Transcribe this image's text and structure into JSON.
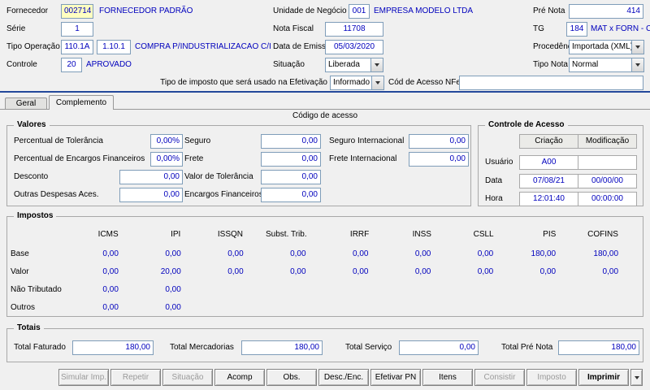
{
  "colors": {
    "field_text_blue": "#0000bd",
    "fornecedor_highlight": "#ffffc0",
    "separator_blue": "#23489b"
  },
  "header": {
    "fornecedor": {
      "label": "Fornecedor",
      "code": "002714",
      "name": "FORNECEDOR PADRÃO"
    },
    "unidade_negocio": {
      "label": "Unidade de Negócio",
      "code": "001",
      "name": "EMPRESA MODELO LTDA"
    },
    "pre_nota": {
      "label": "Pré Nota",
      "value": "414"
    },
    "serie": {
      "label": "Série",
      "value": "1"
    },
    "nota_fiscal": {
      "label": "Nota Fiscal",
      "value": "11708"
    },
    "tg": {
      "label": "TG",
      "code": "184",
      "name": "MAT x FORN - CR"
    },
    "tipo_operacao": {
      "label": "Tipo Operação",
      "code1": "110.1A",
      "code2": "1.10.1",
      "desc": "COMPRA P/INDUSTRIALIZACAO C/ICMS"
    },
    "data_emissao": {
      "label": "Data de Emissão",
      "value": "05/03/2020"
    },
    "procedencia": {
      "label": "Procedência",
      "value": "Importada (XML)"
    },
    "controle": {
      "label": "Controle",
      "code": "20",
      "name": "APROVADO"
    },
    "situacao": {
      "label": "Situação",
      "value": "Liberada"
    },
    "tipo_nota": {
      "label": "Tipo Nota",
      "value": "Normal"
    },
    "tipo_imposto": {
      "label": "Tipo de imposto que será usado na Efetivação",
      "value": "Informado"
    },
    "cod_acesso_nfe": {
      "label": "Cód de Acesso NFe",
      "value": ""
    }
  },
  "tabs": [
    {
      "label": "Geral"
    },
    {
      "label": "Complemento"
    }
  ],
  "active_tab": "Complemento",
  "section_title": "Código de acesso",
  "valores": {
    "title": "Valores",
    "col1": [
      {
        "label": "Percentual de Tolerância",
        "value": "0,00%"
      },
      {
        "label": "Percentual de Encargos Financeiros",
        "value": "0,00%"
      },
      {
        "label": "Desconto",
        "value": "0,00"
      },
      {
        "label": "Outras Despesas Aces.",
        "value": "0,00"
      }
    ],
    "col2": [
      {
        "label": "Seguro",
        "value": "0,00"
      },
      {
        "label": "Frete",
        "value": "0,00"
      },
      {
        "label": "Valor de Tolerância",
        "value": "0,00"
      },
      {
        "label": "Encargos Financeiros",
        "value": "0,00"
      }
    ],
    "col3": [
      {
        "label": "Seguro Internacional",
        "value": "0,00"
      },
      {
        "label": "Frete Internacional",
        "value": "0,00"
      }
    ]
  },
  "controle_acesso": {
    "title": "Controle de Acesso",
    "columns": [
      "Criação",
      "Modificação"
    ],
    "rows": [
      {
        "label": "Usuário",
        "criacao": "A00",
        "modificacao": ""
      },
      {
        "label": "Data",
        "criacao": "07/08/21",
        "modificacao": "00/00/00"
      },
      {
        "label": "Hora",
        "criacao": "12:01:40",
        "modificacao": "00:00:00"
      }
    ]
  },
  "impostos": {
    "title": "Impostos",
    "columns": [
      "ICMS",
      "IPI",
      "ISSQN",
      "Subst. Trib.",
      "IRRF",
      "INSS",
      "CSLL",
      "PIS",
      "COFINS"
    ],
    "rows": [
      {
        "label": "Base",
        "values": [
          "0,00",
          "0,00",
          "0,00",
          "0,00",
          "0,00",
          "0,00",
          "0,00",
          "180,00",
          "180,00"
        ]
      },
      {
        "label": "Valor",
        "values": [
          "0,00",
          "20,00",
          "0,00",
          "0,00",
          "0,00",
          "0,00",
          "0,00",
          "0,00",
          "0,00"
        ]
      },
      {
        "label": "Não Tributado",
        "values": [
          "0,00",
          "0,00",
          "",
          "",
          "",
          "",
          "",
          "",
          ""
        ]
      },
      {
        "label": "Outros",
        "values": [
          "0,00",
          "0,00",
          "",
          "",
          "",
          "",
          "",
          "",
          ""
        ]
      }
    ]
  },
  "totais": {
    "title": "Totais",
    "items": [
      {
        "label": "Total Faturado",
        "value": "180,00"
      },
      {
        "label": "Total Mercadorias",
        "value": "180,00"
      },
      {
        "label": "Total Serviço",
        "value": "0,00"
      },
      {
        "label": "Total Pré Nota",
        "value": "180,00"
      }
    ]
  },
  "buttons": [
    {
      "label": "Simular Imp.",
      "enabled": false
    },
    {
      "label": "Repetir",
      "enabled": false
    },
    {
      "label": "Situação",
      "enabled": false
    },
    {
      "label": "Acomp",
      "enabled": true
    },
    {
      "label": "Obs.",
      "enabled": true
    },
    {
      "label": "Desc./Enc.",
      "enabled": true
    },
    {
      "label": "Efetivar PN",
      "enabled": true
    },
    {
      "label": "Itens",
      "enabled": true
    },
    {
      "label": "Consistir",
      "enabled": false
    },
    {
      "label": "Imposto",
      "enabled": false
    },
    {
      "label": "Imprimir",
      "enabled": true
    }
  ]
}
